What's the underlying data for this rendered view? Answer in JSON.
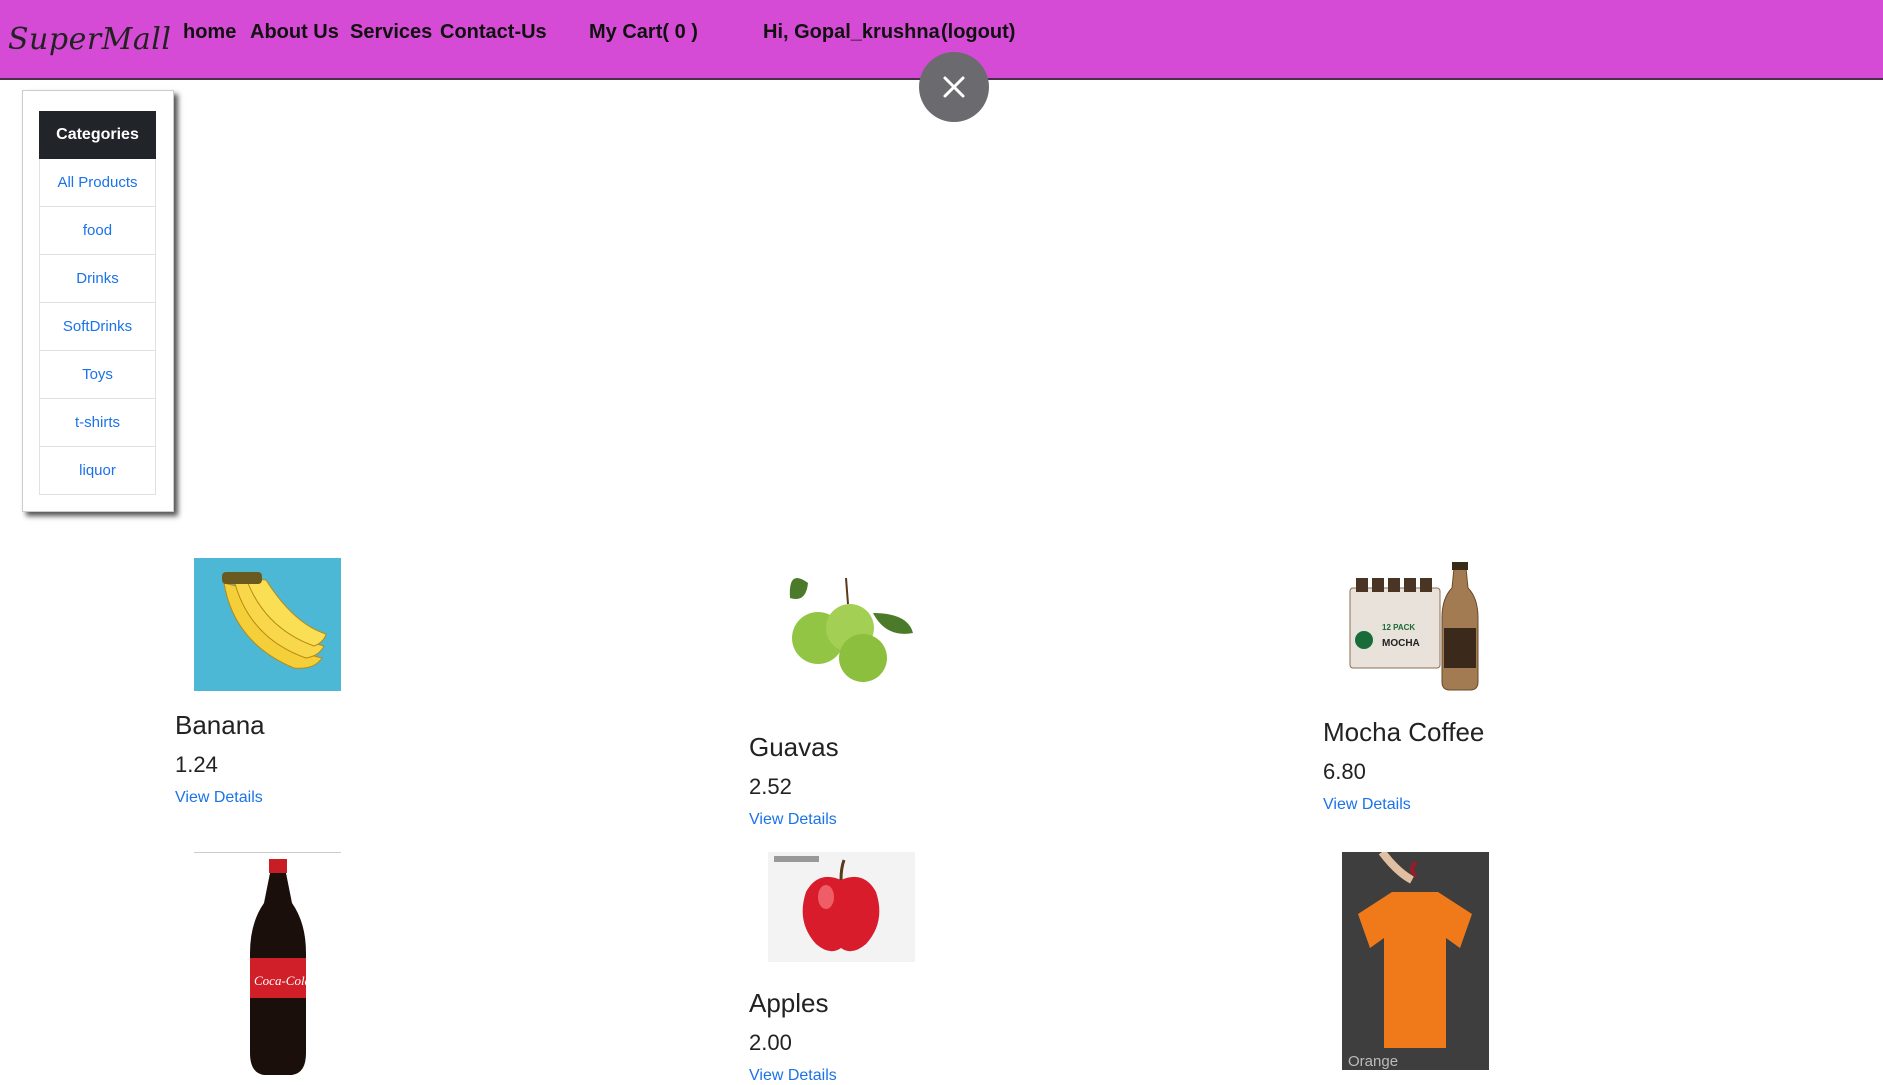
{
  "brand": "SuperMall",
  "nav": {
    "home": "home",
    "about": "About Us",
    "services": "Services",
    "contact": "Contact-Us",
    "cart": "My Cart( 0 )",
    "greeting": "Hi, Gopal_krushna",
    "logout": "(logout)"
  },
  "categories": {
    "title": "Categories",
    "items": [
      "All Products",
      "food",
      "Drinks",
      "SoftDrinks",
      "Toys",
      "t-shirts",
      "liquor"
    ]
  },
  "products": [
    {
      "name": "Banana",
      "price": "1.24",
      "link": "View Details"
    },
    {
      "name": "Guavas",
      "price": "2.52",
      "link": "View Details"
    },
    {
      "name": "Mocha Coffee",
      "price": "6.80",
      "link": "View Details"
    },
    {
      "name": "Apples",
      "price": "2.00",
      "link": "View Details"
    }
  ],
  "image_text": {
    "cola_logo": "Coca-Cola",
    "coffee_pack": "12 PACK",
    "coffee_label": "MOCHA",
    "shirt_caption": "Orange"
  },
  "colors": {
    "navbar": "#d64bd6",
    "link": "#1a73e8",
    "category_header": "#212529"
  }
}
